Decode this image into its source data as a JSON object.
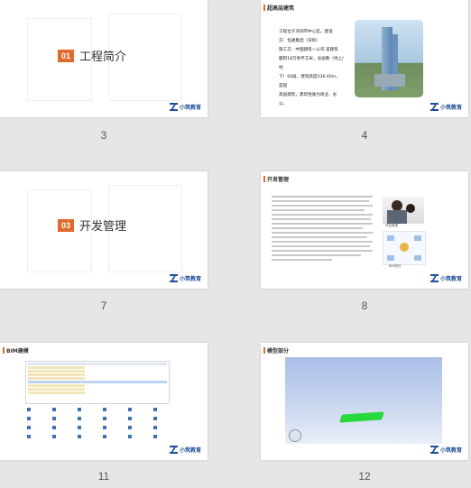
{
  "slides": [
    {
      "number": "3",
      "section_num": "01",
      "section_title": "工程简介"
    },
    {
      "number": "4",
      "header": "超高层建筑",
      "body_lines": [
        "工程位于深圳市中心区。建设",
        "方：恒通集团（深圳）",
        "施工方：中国建筑一公司 该建筑",
        "面积18万余平方米，总层数（地上/地",
        "下）64层，建筑高度336.40m，是超",
        "高层建筑，建筑性质为商业、办公。"
      ]
    },
    {
      "number": "7",
      "section_num": "03",
      "section_title": "开发管理"
    },
    {
      "number": "8",
      "header": "开发管理",
      "caption_top": "项目管理",
      "caption_bottom": "BIM软件"
    },
    {
      "number": "11",
      "header": "BIM建模"
    },
    {
      "number": "12",
      "header": "模型部分"
    }
  ],
  "logo_text": "小筑教育"
}
